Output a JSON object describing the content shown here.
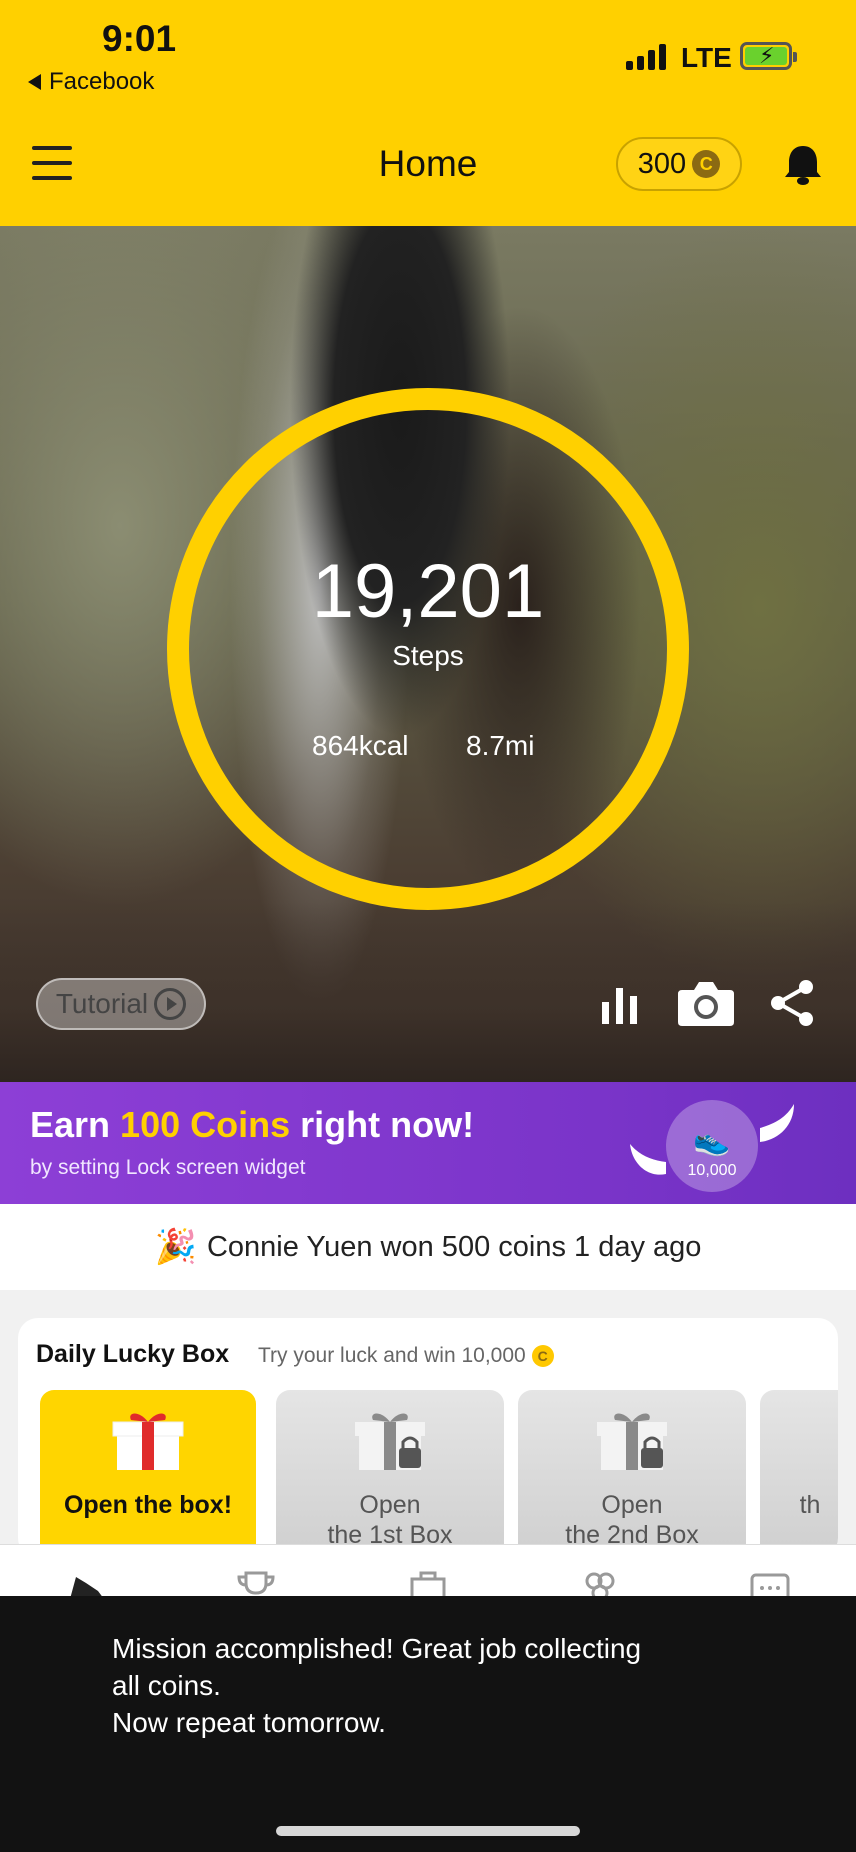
{
  "status_bar": {
    "time": "9:01",
    "back_app": "Facebook",
    "network": "LTE"
  },
  "header": {
    "title": "Home",
    "coins": "300",
    "coin_symbol": "C"
  },
  "hero": {
    "steps": "19,201",
    "steps_label": "Steps",
    "kcal": "864kcal",
    "distance": "8.7mi",
    "tutorial_label": "Tutorial"
  },
  "promo": {
    "title_prefix": "Earn ",
    "title_highlight": "100 Coins",
    "title_suffix": " right now!",
    "subtitle": "by setting Lock screen widget",
    "badge_value": "10,000"
  },
  "winner": {
    "text": "Connie Yuen won 500 coins 1 day ago",
    "icon": "party-popper-icon"
  },
  "lucky_box": {
    "title": "Daily Lucky Box",
    "subtitle": "Try your luck and win 10,000",
    "coin_symbol": "C",
    "boxes": [
      {
        "label": "Open the box!"
      },
      {
        "label": "Open\nthe 1st Box"
      },
      {
        "label": "Open\nthe 2nd Box"
      },
      {
        "label": "th"
      }
    ]
  },
  "nav_icons": [
    "shoe-icon",
    "trophy-icon",
    "shopping-bag-icon",
    "clover-icon",
    "chat-icon"
  ],
  "toast": {
    "message": "Mission accomplished! Great job collecting\nall coins.\nNow repeat tomorrow."
  },
  "colors": {
    "brand_yellow": "#FFD000",
    "promo_purple": "#8d3fd6"
  }
}
